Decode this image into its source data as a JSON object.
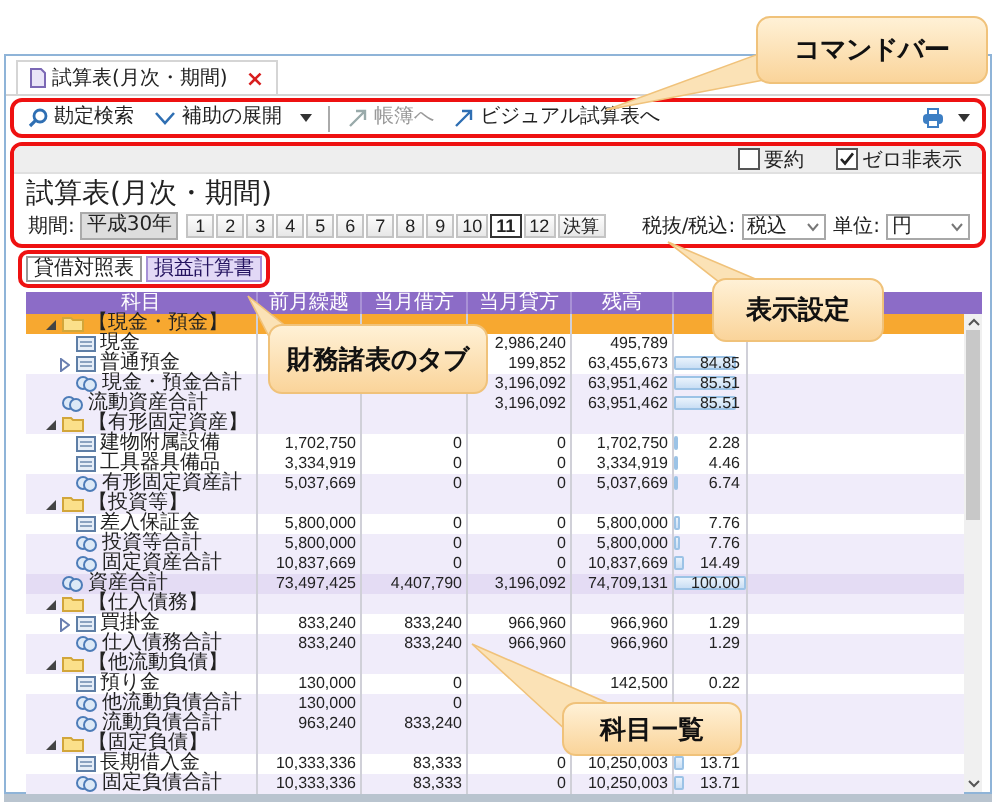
{
  "document_tab": {
    "title": "試算表(月次・期間)",
    "close": "×"
  },
  "command_bar": {
    "highlighted": true,
    "items": [
      {
        "kind": "search",
        "label": "勘定検索",
        "disabled": false,
        "menu": false
      },
      {
        "kind": "expand",
        "label": "補助の展開",
        "disabled": false,
        "menu": true
      },
      {
        "kind": "jump",
        "label": "帳簿へ",
        "disabled": true,
        "menu": false
      },
      {
        "kind": "jump",
        "label": "ビジュアル試算表へ",
        "disabled": false,
        "menu": false
      }
    ]
  },
  "settings": {
    "highlighted": true,
    "options": [
      {
        "label": "要約",
        "checked": false
      },
      {
        "label": "ゼロ非表示",
        "checked": true
      }
    ],
    "title": "試算表(月次・期間)",
    "period_label": "期間:",
    "year": "平成30年",
    "months": [
      {
        "label": "1",
        "selected": false
      },
      {
        "label": "2",
        "selected": false
      },
      {
        "label": "3",
        "selected": false
      },
      {
        "label": "4",
        "selected": false
      },
      {
        "label": "5",
        "selected": false
      },
      {
        "label": "6",
        "selected": false
      },
      {
        "label": "7",
        "selected": false
      },
      {
        "label": "8",
        "selected": false
      },
      {
        "label": "9",
        "selected": false
      },
      {
        "label": "10",
        "selected": false
      },
      {
        "label": "11",
        "selected": true
      },
      {
        "label": "12",
        "selected": false
      },
      {
        "label": "決算",
        "selected": false
      }
    ],
    "tax_label": "税抜/税込:",
    "tax_value": "税込",
    "unit_label": "単位:",
    "unit_value": "円"
  },
  "report_tabs": {
    "highlighted": true,
    "tabs": [
      {
        "label": "貸借対照表",
        "selected": true
      },
      {
        "label": "損益計算書",
        "selected": false
      }
    ]
  },
  "table": {
    "columns": [
      "科目",
      "前月繰越",
      "当月借方",
      "当月貸方",
      "残高"
    ],
    "rows": [
      {
        "name": "【現金・預金】",
        "kind": "group",
        "selected": true,
        "expanded": true,
        "children": [
          {
            "name": "現金",
            "kind": "account",
            "selected": false,
            "cells": {
              "credit": "2,986,240",
              "balance": "495,789"
            }
          },
          {
            "name": "普通預金",
            "kind": "account",
            "selected": false,
            "expanded": false,
            "cells": {
              "credit": "199,852",
              "balance": "63,455,673",
              "ratio": "84.85"
            },
            "level": 0.8485
          },
          {
            "name": "現金・預金合計",
            "kind": "subtotal",
            "selected": false,
            "cells": {
              "credit": "3,196,092",
              "balance": "63,951,462",
              "ratio": "85.51"
            },
            "level": 0.8551
          }
        ]
      },
      {
        "name": "流動資産合計",
        "kind": "subtotal",
        "selected": false,
        "cells": {
          "credit": "3,196,092",
          "balance": "63,951,462",
          "ratio": "85.51"
        },
        "level": 0.8551
      },
      {
        "name": "【有形固定資産】",
        "kind": "group",
        "selected": false,
        "expanded": true,
        "children": [
          {
            "name": "建物附属設備",
            "kind": "account",
            "selected": false,
            "cells": {
              "prev": "1,702,750",
              "debit": "0",
              "credit": "0",
              "balance": "1,702,750",
              "ratio": "2.28"
            },
            "level": 0.0228
          },
          {
            "name": "工具器具備品",
            "kind": "account",
            "selected": false,
            "cells": {
              "prev": "3,334,919",
              "debit": "0",
              "credit": "0",
              "balance": "3,334,919",
              "ratio": "4.46"
            },
            "level": 0.0446
          },
          {
            "name": "有形固定資産計",
            "kind": "subtotal",
            "selected": false,
            "cells": {
              "prev": "5,037,669",
              "debit": "0",
              "credit": "0",
              "balance": "5,037,669",
              "ratio": "6.74"
            },
            "level": 0.0674
          }
        ]
      },
      {
        "name": "【投資等】",
        "kind": "group",
        "selected": false,
        "expanded": true,
        "children": [
          {
            "name": "差入保証金",
            "kind": "account",
            "selected": false,
            "cells": {
              "prev": "5,800,000",
              "debit": "0",
              "credit": "0",
              "balance": "5,800,000",
              "ratio": "7.76"
            },
            "level": 0.0776
          },
          {
            "name": "投資等合計",
            "kind": "subtotal",
            "selected": false,
            "cells": {
              "prev": "5,800,000",
              "debit": "0",
              "credit": "0",
              "balance": "5,800,000",
              "ratio": "7.76"
            },
            "level": 0.0776
          },
          {
            "name": "固定資産合計",
            "kind": "subtotal",
            "selected": false,
            "cells": {
              "prev": "10,837,669",
              "debit": "0",
              "credit": "0",
              "balance": "10,837,669",
              "ratio": "14.49"
            },
            "level": 0.1449
          }
        ]
      },
      {
        "name": "資産合計",
        "kind": "grandtotal",
        "selected": false,
        "cells": {
          "prev": "73,497,425",
          "debit": "4,407,790",
          "credit": "3,196,092",
          "balance": "74,709,131",
          "ratio": "100.00"
        },
        "level": 1.0
      },
      {
        "name": "【仕入債務】",
        "kind": "group",
        "selected": false,
        "expanded": true,
        "children": [
          {
            "name": "買掛金",
            "kind": "account",
            "selected": false,
            "expanded": false,
            "cells": {
              "prev": "833,240",
              "debit": "833,240",
              "credit": "966,960",
              "balance": "966,960",
              "ratio": "1.29"
            }
          },
          {
            "name": "仕入債務合計",
            "kind": "subtotal",
            "selected": false,
            "cells": {
              "prev": "833,240",
              "debit": "833,240",
              "credit": "966,960",
              "balance": "966,960",
              "ratio": "1.29"
            }
          }
        ]
      },
      {
        "name": "【他流動負債】",
        "kind": "group",
        "selected": false,
        "expanded": true,
        "children": [
          {
            "name": "預り金",
            "kind": "account",
            "selected": false,
            "cells": {
              "prev": "130,000",
              "debit": "0",
              "balance": "142,500",
              "ratio": "0.22"
            }
          },
          {
            "name": "他流動負債合計",
            "kind": "subtotal",
            "selected": false,
            "cells": {
              "prev": "130,000",
              "debit": "0"
            }
          },
          {
            "name": "流動負債合計",
            "kind": "subtotal",
            "selected": false,
            "cells": {
              "prev": "963,240",
              "debit": "833,240"
            }
          }
        ]
      },
      {
        "name": "【固定負債】",
        "kind": "group",
        "selected": false,
        "expanded": true,
        "children": [
          {
            "name": "長期借入金",
            "kind": "account",
            "selected": false,
            "cells": {
              "prev": "10,333,336",
              "debit": "83,333",
              "credit": "0",
              "balance": "10,250,003",
              "ratio": "13.71"
            },
            "level": 0.1371
          },
          {
            "name": "固定負債合計",
            "kind": "subtotal",
            "selected": false,
            "cells": {
              "prev": "10,333,336",
              "debit": "83,333",
              "credit": "0",
              "balance": "10,250,003",
              "ratio": "13.71"
            },
            "level": 0.1371
          }
        ]
      }
    ]
  },
  "callouts": [
    {
      "text": "コマンドバー"
    },
    {
      "text": "表示設定"
    },
    {
      "text": "財務諸表のタブ"
    },
    {
      "text": "科目一覧"
    }
  ]
}
